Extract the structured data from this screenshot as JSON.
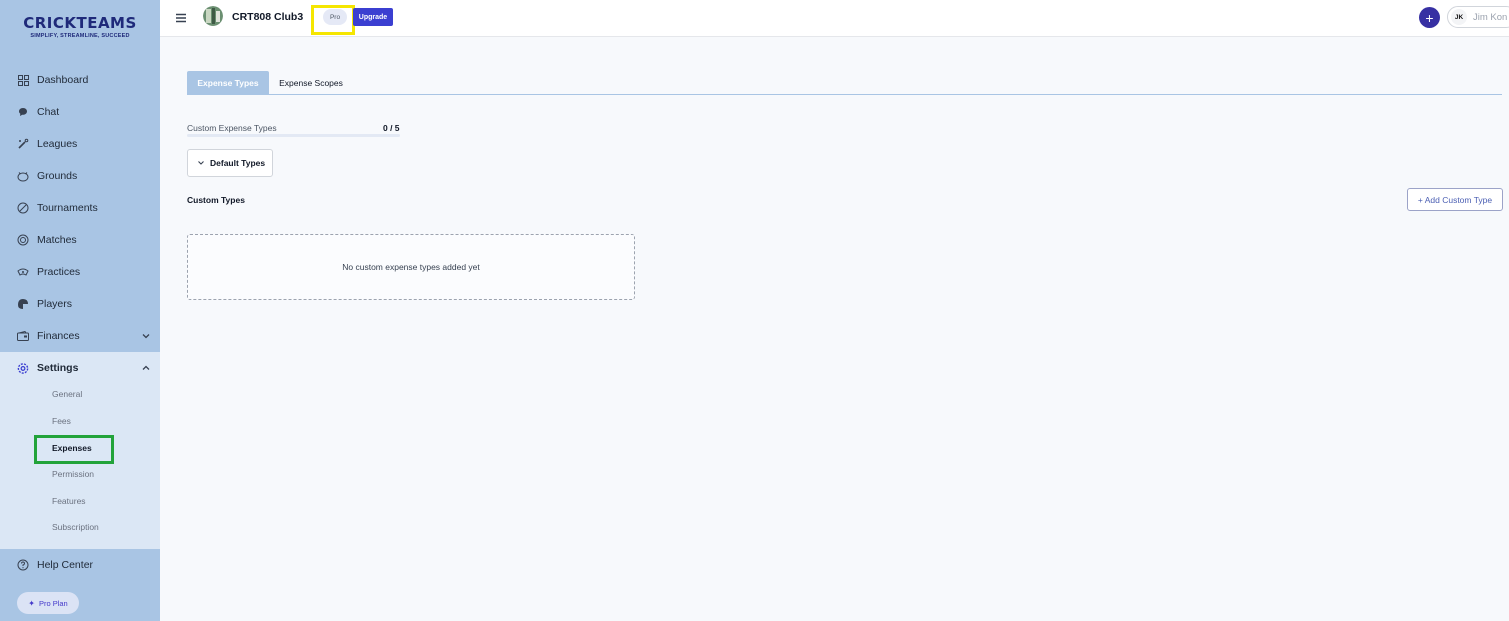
{
  "logo": {
    "title": "CRICKTEAMS",
    "tagline": "SIMPLIFY, STREAMLINE, SUCCEED"
  },
  "sidebar": {
    "items": [
      {
        "label": "Dashboard",
        "icon": "dashboard-grid-icon"
      },
      {
        "label": "Chat",
        "icon": "chat-bubble-icon"
      },
      {
        "label": "Leagues",
        "icon": "cricket-bat-icon"
      },
      {
        "label": "Grounds",
        "icon": "ground-icon"
      },
      {
        "label": "Tournaments",
        "icon": "ball-icon"
      },
      {
        "label": "Matches",
        "icon": "coin-icon"
      },
      {
        "label": "Practices",
        "icon": "practice-icon"
      },
      {
        "label": "Players",
        "icon": "helmet-icon"
      },
      {
        "label": "Finances",
        "icon": "wallet-icon"
      },
      {
        "label": "Settings",
        "icon": "gear-icon"
      }
    ],
    "settings_sub": [
      "General",
      "Fees",
      "Expenses",
      "Permission",
      "Features",
      "Subscription"
    ],
    "active_sub": "Expenses",
    "help": "Help Center",
    "pro_plan": "Pro Plan"
  },
  "topbar": {
    "club_name": "CRT808 Club3",
    "plan_chip": "Pro",
    "upgrade": "Upgrade",
    "add_symbol": "+",
    "user_initials": "JK",
    "user_name": "Jim Kon"
  },
  "tabs": [
    "Expense Types",
    "Expense Scopes"
  ],
  "quota": {
    "label": "Custom Expense Types",
    "value": "0 / 5",
    "used": 0,
    "max": 5
  },
  "default_types": "Default Types",
  "custom_types": {
    "title": "Custom Types",
    "add_button": "+ Add Custom Type",
    "empty": "No custom expense types added yet"
  },
  "colors": {
    "sidebar": "#a9c5e4",
    "accent": "#3b3fd1",
    "highlight_green": "#22a33a",
    "highlight_yellow": "#f5e600"
  }
}
